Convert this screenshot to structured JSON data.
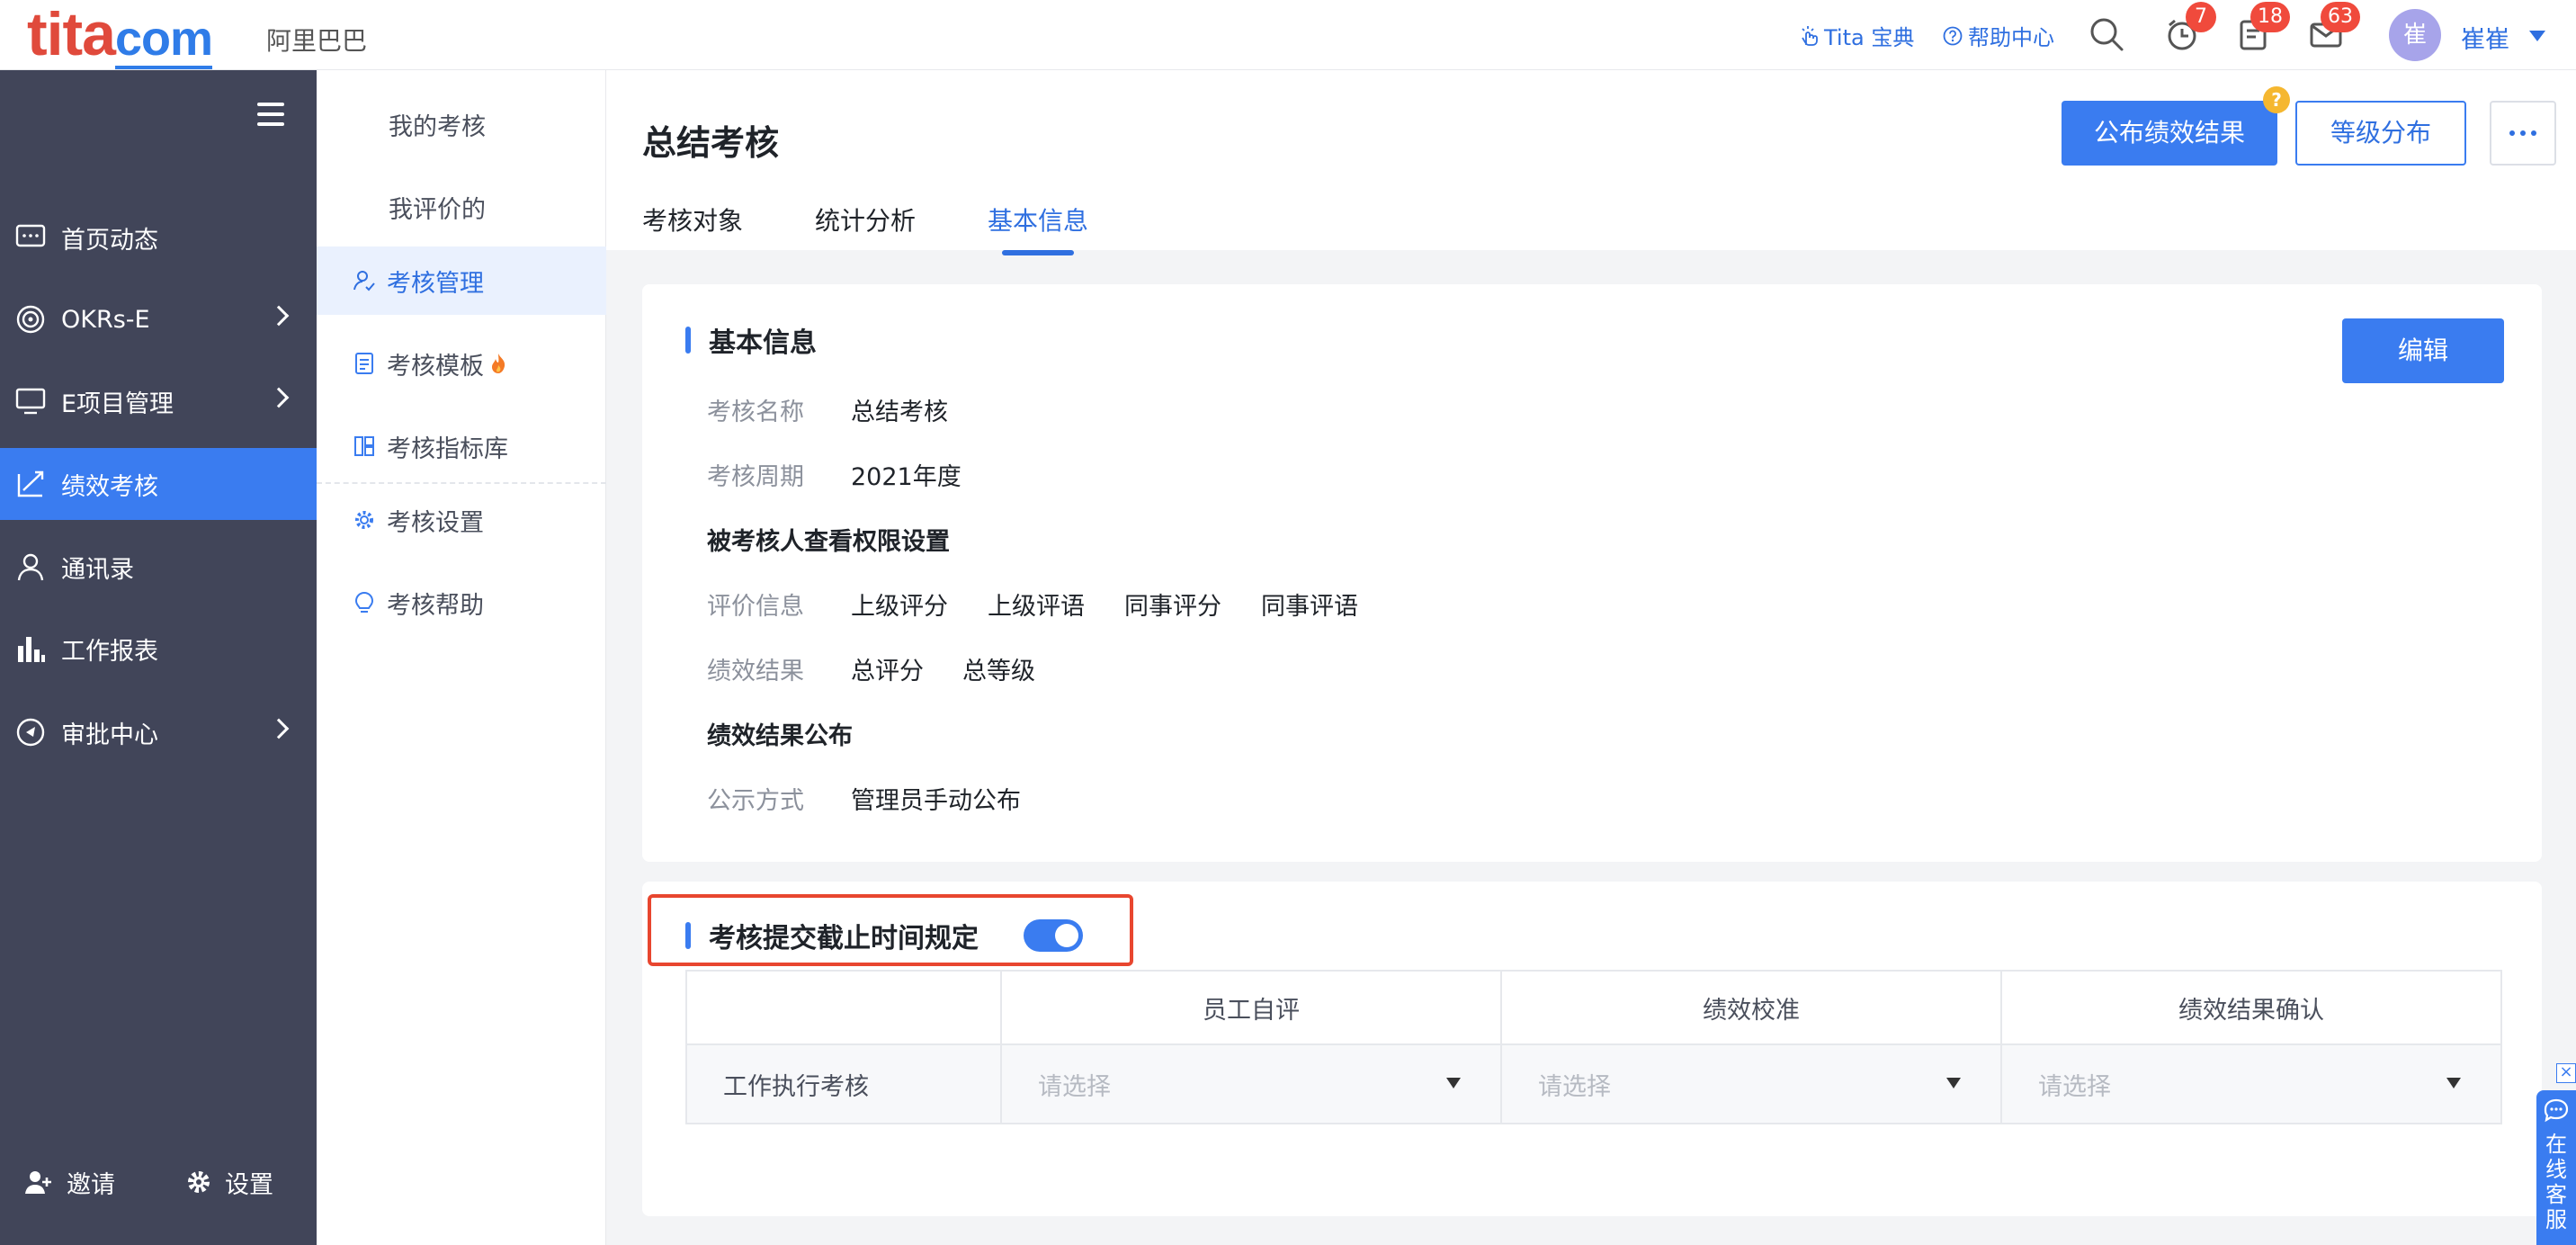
{
  "topbar": {
    "logo_main": "tita",
    "logo_suffix": "com",
    "org_name": "阿里巴巴",
    "links": [
      {
        "label": "Tita 宝典",
        "icon": "hand-pointer-icon"
      },
      {
        "label": "帮助中心",
        "icon": "question-circle-icon"
      }
    ],
    "badges": {
      "reminders": "7",
      "tasks": "18",
      "messages": "63"
    },
    "avatar_text": "崔",
    "user_name": "崔崔"
  },
  "sidebar": {
    "items": [
      {
        "label": "首页动态",
        "icon": "chat-bubble-icon"
      },
      {
        "label": "OKRs-E",
        "icon": "target-icon"
      },
      {
        "label": "E项目管理",
        "icon": "monitor-icon"
      },
      {
        "label": "绩效考核",
        "icon": "trend-chart-icon"
      },
      {
        "label": "通讯录",
        "icon": "person-icon"
      },
      {
        "label": "工作报表",
        "icon": "bar-chart-icon"
      },
      {
        "label": "审批中心",
        "icon": "compass-icon"
      }
    ],
    "invite_label": "邀请",
    "settings_label": "设置"
  },
  "subnav": {
    "items": [
      {
        "label": "我的考核"
      },
      {
        "label": "我评价的"
      },
      {
        "label": "考核管理",
        "icon": "user-manage-icon"
      },
      {
        "label": "考核模板",
        "icon": "document-icon"
      },
      {
        "label": "考核指标库",
        "icon": "grid-icon"
      },
      {
        "label": "考核设置",
        "icon": "gear-icon"
      },
      {
        "label": "考核帮助",
        "icon": "bulb-icon"
      }
    ]
  },
  "main": {
    "title": "总结考核",
    "tabs": [
      {
        "label": "考核对象"
      },
      {
        "label": "统计分析"
      },
      {
        "label": "基本信息"
      }
    ],
    "publish_button": "公布绩效结果",
    "help_mark": "?",
    "grade_button": "等级分布"
  },
  "basic_info": {
    "title": "基本信息",
    "edit_button": "编辑",
    "name_label": "考核名称",
    "name_value": "总结考核",
    "period_label": "考核周期",
    "period_value": "2021年度",
    "permission_heading": "被考核人查看权限设置",
    "eval_label": "评价信息",
    "eval_values": [
      "上级评分",
      "上级评语",
      "同事评分",
      "同事评语"
    ],
    "result_label": "绩效结果",
    "result_values": [
      "总评分",
      "总等级"
    ],
    "publish_heading": "绩效结果公布",
    "publish_method_label": "公示方式",
    "publish_method_value": "管理员手动公布"
  },
  "deadline": {
    "title": "考核提交截止时间规定",
    "toggle_on": true,
    "columns": [
      "",
      "员工自评",
      "绩效校准",
      "绩效结果确认"
    ],
    "row_label": "工作执行考核",
    "placeholder": "请选择"
  },
  "service": {
    "label": "在线客服",
    "close": "×"
  },
  "colors": {
    "accent": "#3a7cf0",
    "sidebar_bg": "#414559",
    "badge_red": "#f04a3c",
    "highlight_red": "#e8462f"
  }
}
